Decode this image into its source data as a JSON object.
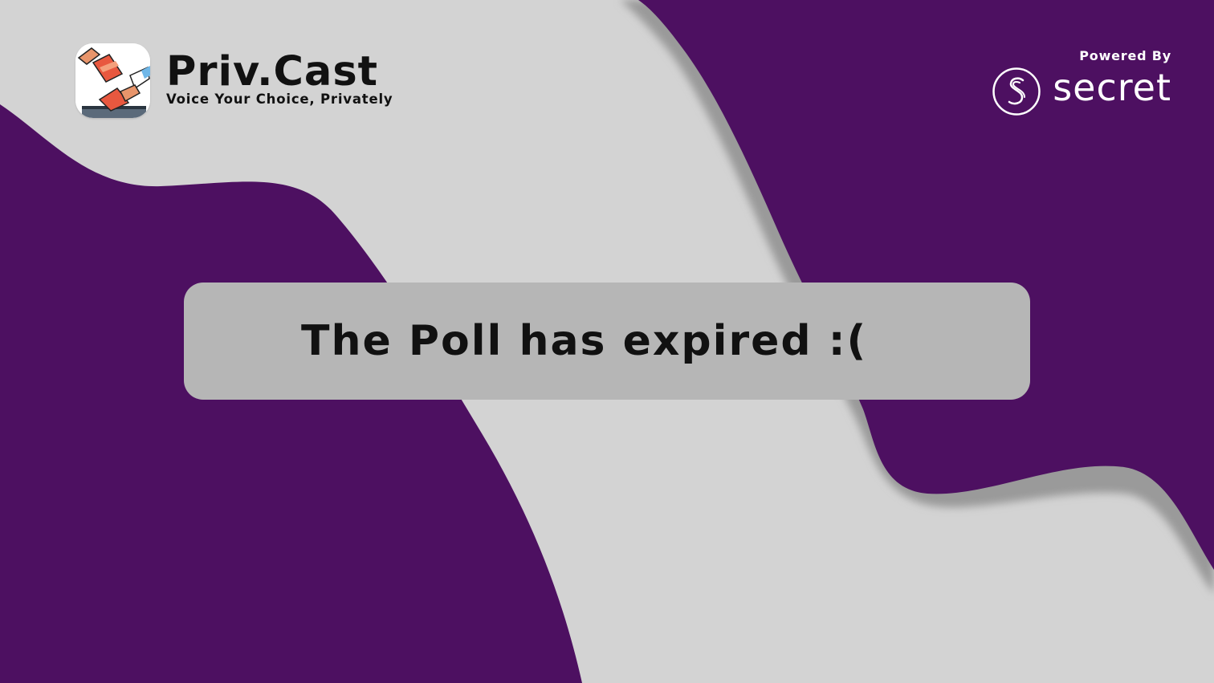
{
  "brand": {
    "title": "Priv.Cast",
    "tagline": "Voice Your Choice, Privately",
    "icon": "ballot-box-icon"
  },
  "powered_by": {
    "label": "Powered By",
    "name": "secret",
    "icon": "secret-network-logo-icon"
  },
  "message": {
    "text": "The Poll has expired :("
  },
  "colors": {
    "purple": "#4d1061",
    "background_gray": "#d3d3d3",
    "message_box": "#b6b6b6",
    "text_dark": "#111111",
    "white": "#ffffff"
  }
}
